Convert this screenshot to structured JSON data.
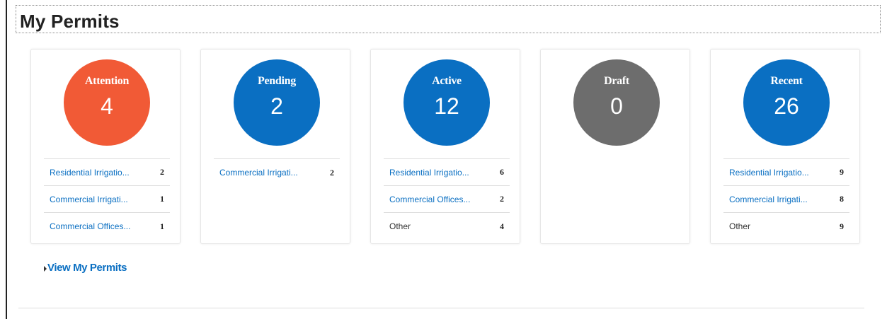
{
  "page": {
    "title": "My Permits"
  },
  "cards": [
    {
      "label": "Attention",
      "count": "4",
      "color": "#f15a36",
      "items": [
        {
          "label": "Residential Irrigatio...",
          "count": "2"
        },
        {
          "label": "Commercial Irrigati...",
          "count": "1"
        },
        {
          "label": "Commercial Offices...",
          "count": "1"
        }
      ]
    },
    {
      "label": "Pending",
      "count": "2",
      "color": "#0a6fc2",
      "items": [
        {
          "label": "Commercial Irrigati...",
          "count": "2"
        }
      ]
    },
    {
      "label": "Active",
      "count": "12",
      "color": "#0a6fc2",
      "items": [
        {
          "label": "Residential Irrigatio...",
          "count": "6"
        },
        {
          "label": "Commercial Offices...",
          "count": "2"
        },
        {
          "label": "Other",
          "count": "4"
        }
      ]
    },
    {
      "label": "Draft",
      "count": "0",
      "color": "#6d6d6d",
      "items": []
    },
    {
      "label": "Recent",
      "count": "26",
      "color": "#0a6fc2",
      "items": [
        {
          "label": "Residential Irrigatio...",
          "count": "9"
        },
        {
          "label": "Commercial Irrigati...",
          "count": "8"
        },
        {
          "label": "Other",
          "count": "9"
        }
      ]
    }
  ],
  "footer": {
    "view_link": "View My Permits",
    "caret_icon": "caret-right-icon"
  }
}
